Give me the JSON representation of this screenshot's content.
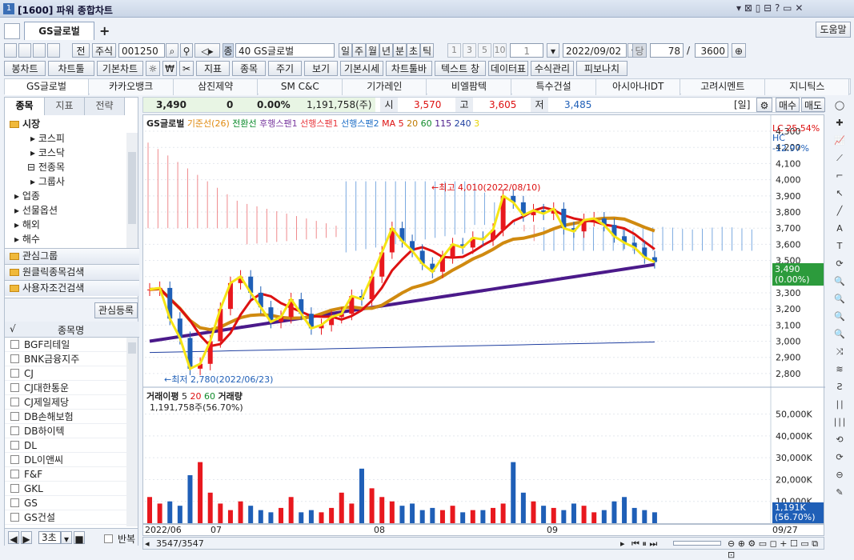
{
  "window": {
    "title": "[1600] 파워 종합차트",
    "help": "도움말"
  },
  "tabs": {
    "active": "GS글로벌",
    "add": "+"
  },
  "toolbar1": {
    "jeon": "전",
    "market": "주식",
    "code": "001250",
    "name_code": "40",
    "name": "GS글로벌",
    "periods": [
      "일",
      "주",
      "월",
      "년",
      "분",
      "초",
      "틱"
    ],
    "minis": [
      "1",
      "3",
      "5",
      "10"
    ],
    "unit": "1",
    "date": "2022/09/02",
    "dang": "당",
    "count": "78",
    "slash": "/",
    "total": "3600"
  },
  "toolbar2": {
    "items": [
      "봉차트",
      "차트툴",
      "기본차트",
      "☼",
      "₩",
      "✂",
      "지표",
      "종목",
      "주기",
      "보기",
      "기본시세",
      "차트툴바",
      "텍스트 창",
      "데이터표",
      "수식관리",
      "피보나치"
    ]
  },
  "stocks": [
    "GS글로벌",
    "카카오뱅크",
    "삼진제약",
    "SM C&C",
    "기가레인",
    "비엘팜텍",
    "특수건설",
    "아시아나IDT",
    "고려시멘트",
    "지니틱스"
  ],
  "left": {
    "tabs": [
      "종목",
      "지표",
      "전략"
    ],
    "tree": [
      "시장",
      "코스피",
      "코스닥",
      "전종목",
      "그룹사",
      "업종",
      "선물옵션",
      "해외",
      "해수"
    ],
    "groups": [
      "관심그룹",
      "원클릭종목검색",
      "사용자조건검색"
    ],
    "register": "관심등록",
    "col_header": "종목명",
    "items": [
      "BGF리테일",
      "BNK금융지주",
      "CJ",
      "CJ대한통운",
      "CJ제일제당",
      "DB손해보험",
      "DB하이텍",
      "DL",
      "DL이앤씨",
      "F&F",
      "GKL",
      "GS",
      "GS건설"
    ],
    "nav": "3초",
    "repeat": "반복"
  },
  "quote": {
    "price": "3,490",
    "change": "0",
    "pct": "0.00%",
    "volume": "1,191,758(주)",
    "open_label": "시",
    "open": "3,570",
    "high_label": "고",
    "high": "3,605",
    "low_label": "저",
    "low": "3,485",
    "period": "[일]",
    "buy": "매수",
    "sell": "매도"
  },
  "legend": {
    "name": "GS글로벌",
    "kijun": "기준선(26)",
    "tenkan": "전환선",
    "chikou": "후행스팬1",
    "senkouA": "선행스팬1",
    "senkouB": "선행스팬2",
    "ma": "MA",
    "ma5": "5",
    "ma20": "20",
    "ma60": "60",
    "ma115": "115",
    "ma240": "240",
    "ma3": "3"
  },
  "annot": {
    "high": "←최고 4,010(2022/08/10)",
    "low": "←최저 2,780(2022/06/23)",
    "lc": "LC  25.54%",
    "hc": "HC -12.97%",
    "last": "3,490",
    "lastpct": "(0.00%)"
  },
  "vol": {
    "legend": "거래이평",
    "v5": "5",
    "v20": "20",
    "v60": "60",
    "vol": "거래량",
    "info": "1,191,758주(56.70%)",
    "last": "1,191K",
    "lastpct": "(56.70%)"
  },
  "bottom": {
    "range": "3547/3547",
    "date_end": "09/27"
  },
  "colors": {
    "up": "#e8181e",
    "down": "#1f5fb7",
    "ma5": "#f5e414",
    "ma20": "#d11",
    "ma60": "#d08a10",
    "long": "#4b1a8a"
  },
  "chart_data": {
    "type": "candlestick",
    "price_axis": [
      4300,
      4200,
      4100,
      4000,
      3900,
      3800,
      3700,
      3600,
      3500,
      3400,
      3300,
      3200,
      3100,
      3000,
      2900,
      2800
    ],
    "volume_axis": [
      "50,000K",
      "40,000K",
      "30,000K",
      "20,000K",
      "10,000K"
    ],
    "x_labels": [
      "2022/06",
      "07",
      "08",
      "09"
    ],
    "y_range": [
      2750,
      4330
    ],
    "last_price": 3490,
    "high": 4010,
    "low": 2780,
    "close": [
      3320,
      3330,
      3140,
      3020,
      2830,
      2860,
      3000,
      3200,
      3360,
      3400,
      3300,
      3210,
      3120,
      3150,
      3260,
      3170,
      3080,
      3100,
      3150,
      3170,
      3280,
      3260,
      3400,
      3550,
      3700,
      3620,
      3560,
      3480,
      3430,
      3520,
      3600,
      3580,
      3640,
      3630,
      3690,
      3900,
      3860,
      3780,
      3810,
      3790,
      3820,
      3700,
      3680,
      3750,
      3760,
      3720,
      3650,
      3610,
      3580,
      3520,
      3490
    ],
    "volume": [
      12,
      9,
      10,
      8,
      22,
      28,
      14,
      9,
      6,
      10,
      8,
      6,
      5,
      7,
      12,
      5,
      6,
      5,
      7,
      14,
      9,
      25,
      16,
      12,
      10,
      8,
      9,
      6,
      7,
      6,
      8,
      5,
      6,
      6,
      7,
      9,
      28,
      14,
      10,
      8,
      7,
      6,
      9,
      8,
      5,
      6,
      10,
      12,
      7,
      6,
      5
    ]
  }
}
